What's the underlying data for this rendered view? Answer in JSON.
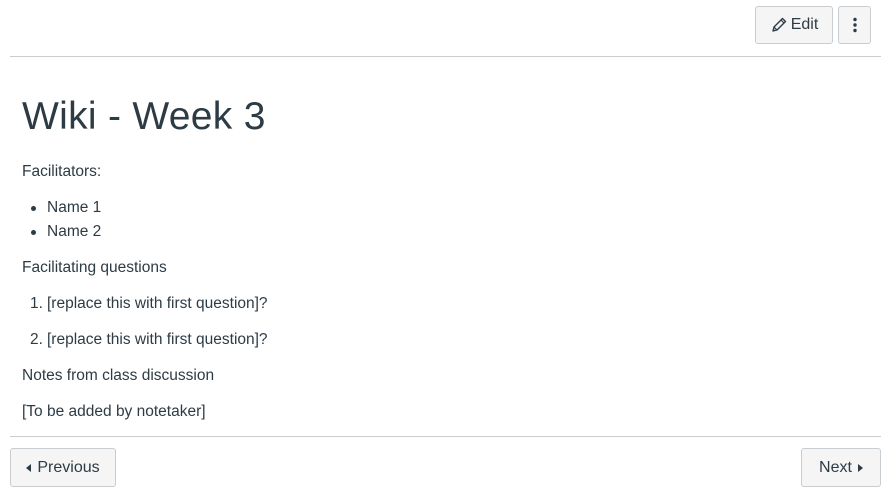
{
  "toolbar": {
    "edit_label": "Edit",
    "edit_icon": "pencil-icon",
    "more_icon": "kebab-menu-icon"
  },
  "page": {
    "title": "Wiki - Week 3",
    "facilitators_label": "Facilitators:",
    "facilitators": [
      "Name 1",
      "Name 2"
    ],
    "questions_label": "Facilitating questions",
    "questions": [
      {
        "number": "1.",
        "text": "[replace this with first question]?"
      },
      {
        "number": "2.",
        "text": "[replace this with first question]?"
      }
    ],
    "notes_label": "Notes from class discussion",
    "notes_text": "[To be added by notetaker]"
  },
  "footer": {
    "previous_label": "Previous",
    "next_label": "Next"
  },
  "colors": {
    "text": "#2d3b45",
    "border": "#c7cdd1",
    "button_bg": "#f5f5f5"
  }
}
